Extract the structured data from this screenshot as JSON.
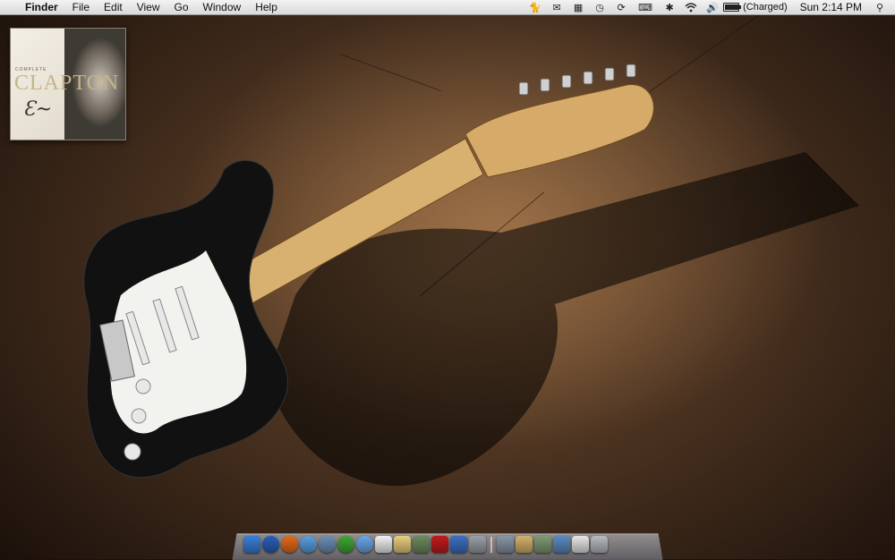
{
  "menubar": {
    "apple_glyph": "",
    "app_name": "Finder",
    "menus": [
      "File",
      "Edit",
      "View",
      "Go",
      "Window",
      "Help"
    ],
    "status_icons": [
      "cat-icon",
      "mail-icon",
      "calendar-icon",
      "time-machine-icon",
      "sync-icon",
      "keyboard-icon",
      "bluetooth-icon",
      "wifi-icon",
      "volume-icon",
      "battery-icon",
      "spotlight-icon"
    ],
    "battery_status": "(Charged)",
    "clock": "Sun 2:14 PM"
  },
  "desktop": {
    "album_item": {
      "subtitle": "COMPLETE",
      "title": "CLAPTON"
    }
  },
  "dock": {
    "apps": [
      {
        "name": "finder-icon",
        "color": "#3b7fd9"
      },
      {
        "name": "ie-icon",
        "color": "#2a5fb8"
      },
      {
        "name": "firefox-icon",
        "color": "#e66a1a"
      },
      {
        "name": "safari-icon",
        "color": "#5aa0e0"
      },
      {
        "name": "itunes-icon",
        "color": "#6c8fb5"
      },
      {
        "name": "messenger-icon",
        "color": "#3ea832"
      },
      {
        "name": "ichat-icon",
        "color": "#6aa6e8"
      },
      {
        "name": "ical-icon",
        "color": "#f2f2f2"
      },
      {
        "name": "notes-icon",
        "color": "#e8cf7e"
      },
      {
        "name": "iphoto-icon",
        "color": "#6d8a5f"
      },
      {
        "name": "photo-booth-icon",
        "color": "#c01c1c"
      },
      {
        "name": "word-icon",
        "color": "#3d6fc2"
      },
      {
        "name": "system-prefs-icon",
        "color": "#9aa0a8"
      }
    ],
    "stacks": [
      {
        "name": "documents-stack-icon",
        "color": "#8796a8"
      },
      {
        "name": "applications-stack-icon",
        "color": "#d4b26a"
      },
      {
        "name": "utilities-stack-icon",
        "color": "#7f9a73"
      },
      {
        "name": "downloads-stack-icon",
        "color": "#5a8ac0"
      },
      {
        "name": "preview-icon",
        "color": "#e8e8e8"
      },
      {
        "name": "trash-icon",
        "color": "#b8bcc2"
      }
    ]
  }
}
